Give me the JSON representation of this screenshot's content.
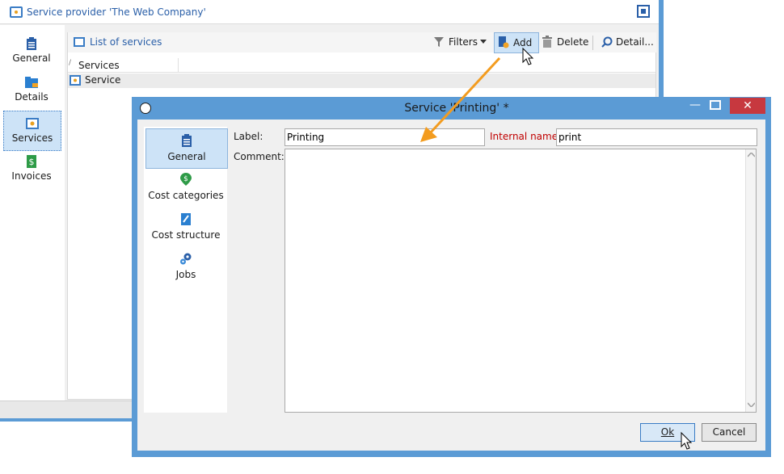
{
  "back_window": {
    "title": "Service provider 'The Web Company'",
    "nav": [
      {
        "label": "General",
        "icon": "clipboard-icon"
      },
      {
        "label": "Details",
        "icon": "folder-icon"
      },
      {
        "label": "Services",
        "icon": "service-icon",
        "selected": true
      },
      {
        "label": "Invoices",
        "icon": "invoice-icon"
      }
    ],
    "list_link": "List of services",
    "toolbar": {
      "filters": "Filters",
      "add": "Add",
      "delete": "Delete",
      "detail": "Detail..."
    },
    "grid": {
      "column_header": "Services",
      "rows": [
        "Service"
      ]
    }
  },
  "dialog": {
    "title": "Service 'Printing' *",
    "nav": [
      {
        "label": "General",
        "icon": "clipboard-icon",
        "selected": true
      },
      {
        "label": "Cost categories",
        "icon": "cost-icon"
      },
      {
        "label": "Cost structure",
        "icon": "structure-icon"
      },
      {
        "label": "Jobs",
        "icon": "gears-icon"
      }
    ],
    "fields": {
      "label_caption": "Label:",
      "label_value": "Printing",
      "internal_name_caption": "Internal name:",
      "internal_name_value": "print",
      "comment_caption": "Comment:",
      "comment_value": ""
    },
    "buttons": {
      "ok": "Ok",
      "cancel": "Cancel"
    }
  },
  "colors": {
    "accent": "#3a7cc5",
    "title_bar": "#5b9bd5",
    "close": "#c7383f",
    "arrow": "#f39c1f",
    "required": "#c00000"
  }
}
